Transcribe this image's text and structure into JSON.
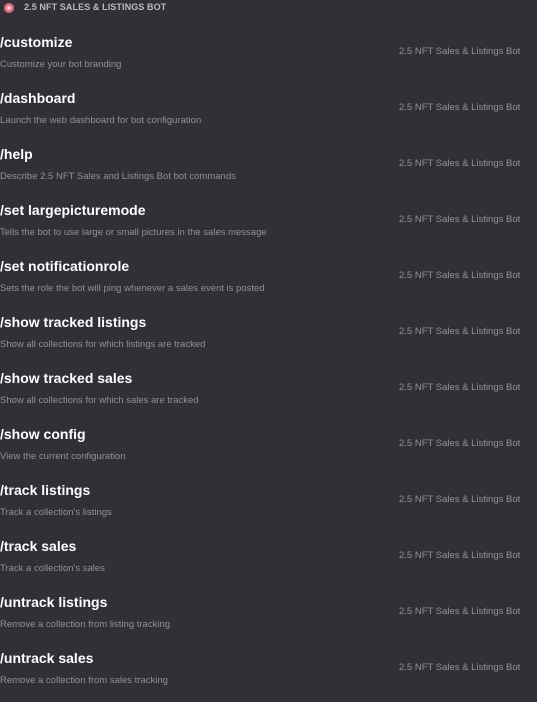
{
  "header": {
    "title": "2.5 NFT SALES & LISTINGS BOT",
    "avatar_icon": "bot-avatar-icon",
    "avatar_color": "#e96b7c"
  },
  "commands": [
    {
      "name": "/customize",
      "description": "Customize your bot branding",
      "source": "2.5 NFT Sales & Listings Bot"
    },
    {
      "name": "/dashboard",
      "description": "Launch the web dashboard for bot configuration",
      "source": "2.5 NFT Sales & Listings Bot"
    },
    {
      "name": "/help",
      "description": "Describe 2.5 NFT Sales and Listings Bot bot commands",
      "source": "2.5 NFT Sales & Listings Bot"
    },
    {
      "name": "/set largepicturemode",
      "description": "Tells the bot to use large or small pictures in the sales message",
      "source": "2.5 NFT Sales & Listings Bot"
    },
    {
      "name": "/set notificationrole",
      "description": "Sets the role the bot will ping whenever a sales event is posted",
      "source": "2.5 NFT Sales & Listings Bot"
    },
    {
      "name": "/show tracked listings",
      "description": "Show all collections for which listings are tracked",
      "source": "2.5 NFT Sales & Listings Bot"
    },
    {
      "name": "/show tracked sales",
      "description": "Show all collections for which sales are tracked",
      "source": "2.5 NFT Sales & Listings Bot"
    },
    {
      "name": "/show config",
      "description": "View the current configuration",
      "source": "2.5 NFT Sales & Listings Bot"
    },
    {
      "name": "/track listings",
      "description": "Track a collection's listings",
      "source": "2.5 NFT Sales & Listings Bot"
    },
    {
      "name": "/track sales",
      "description": "Track a collection's sales",
      "source": "2.5 NFT Sales & Listings Bot"
    },
    {
      "name": "/untrack listings",
      "description": "Remove a collection from listing tracking",
      "source": "2.5 NFT Sales & Listings Bot"
    },
    {
      "name": "/untrack sales",
      "description": "Remove a collection from sales tracking",
      "source": "2.5 NFT Sales & Listings Bot"
    }
  ]
}
